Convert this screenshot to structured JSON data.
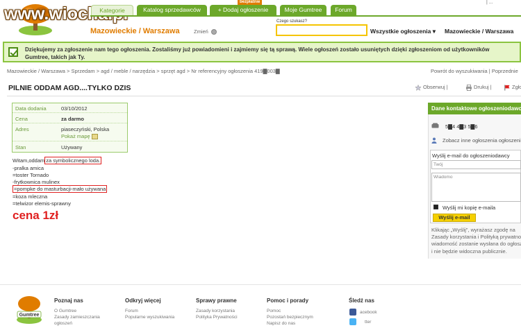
{
  "watermark": "www.wiocha.pl",
  "header": {
    "badge_new": "bezpłatnie",
    "tabs": [
      {
        "label": "Kategorie"
      },
      {
        "label": "Katalog sprzedawców"
      },
      {
        "label": "+ Dodaj ogłoszenie"
      },
      {
        "label": "Moje Gumtree"
      },
      {
        "label": "Forum"
      }
    ],
    "region": "Mazowieckie / Warszawa",
    "change_label": "Zmień",
    "search_label": "Czego szukasz?",
    "search_value": "",
    "category_select": "Wszystkie ogłoszenia ▾",
    "location_select": "Mazowieckie / Warszawa",
    "top_link": "| ..."
  },
  "confirmation": {
    "line1": "Dziękujemy za zgłoszenie nam tego ogłoszenia. Zostaliśmy już powiadomieni i zajmiemy się tą sprawą. Wiele ogłoszeń zostało usuniętych dzięki zgłoszeniom od użytkowników",
    "line2": "Gumtree, takich jak Ty."
  },
  "breadcrumb": "Mazowieckie / Warszawa > Sprzedam > agd / meble / narzędzia > sprzęt agd > Nr referencyjny ogłoszenia 419▇003▇",
  "back_links": "Powrót do wyszukiwania | Poprzednie",
  "ad": {
    "title": "PILNIE ODDAM AGD....TYLKO DZIS",
    "actions": {
      "observe": "Obserwuj",
      "print": "Drukuj",
      "report": "Zgłoś"
    },
    "info": {
      "date_label": "Data dodania",
      "date_value": "03/10/2012",
      "price_label": "Cena",
      "price_value": "za darmo",
      "address_label": "Adres",
      "address_value": "piaseczyński, Polska",
      "map_link": "Pokaż mapę",
      "state_label": "Stan",
      "state_value": "Używany"
    },
    "description": {
      "line1_prefix": "Witam,oddam",
      "line1_highlight": "za symbolicznego loda.",
      "line2": "-pralka amica",
      "line3": "=toster Tornado",
      "line4": "-frytkownica mulinex",
      "line5": "=pompke do masturbacji-mało używana",
      "line6": "=koza mleczna",
      "line7": "=telwizor elemis-sprawny"
    },
    "price_big": "cena 1zł"
  },
  "contact": {
    "header": "Dane kontaktowe ogłoszeniodawcy",
    "phone": "5▇4 4▇3 5▇6",
    "other_ads": "Zobacz inne ogłoszenia ogłoszeniodawcy",
    "form_title": "Wyślij e-mail do ogłoszeniodawcy",
    "name_placeholder": "Twój",
    "message_placeholder": "Wiadomo",
    "copy_label": "Wyślij mi kopię e-maila",
    "send_label": "Wyślij e-mail",
    "legal1": "Klikając „Wyślij”, wyrażasz zgodę na",
    "legal2": "Zasady korzystania i Polityką prywatności",
    "legal3": "wiadomość zostanie wysłana do ogłoszeniodawcy",
    "legal4": "i nie będzie widoczna publicznie."
  },
  "footer": {
    "logo_text": "Gumtree",
    "col1": {
      "head": "Poznaj nas",
      "l1": "O Gumtree",
      "l2": "Zasady zamieszczania",
      "l3": "ogłoszeń"
    },
    "col2": {
      "head": "Odkryj więcej",
      "l1": "Forum",
      "l2": "Popularne wyszukiwania"
    },
    "col3": {
      "head": "Sprawy prawne",
      "l1": "Zasady korzystania",
      "l2": "Polityka Prywatności"
    },
    "col4": {
      "head": "Pomoc i porady",
      "l1": "Pomoc",
      "l2": "Pozostań bezpiecznym",
      "l3": "Napisz do nas"
    },
    "col5": {
      "head": "Śledź nas",
      "l1": "acebook",
      "l2": "tter"
    }
  },
  "colors": {
    "green": "#6ca82a",
    "orange": "#e07c00",
    "red": "#e02020",
    "yellow": "#f5d000"
  }
}
